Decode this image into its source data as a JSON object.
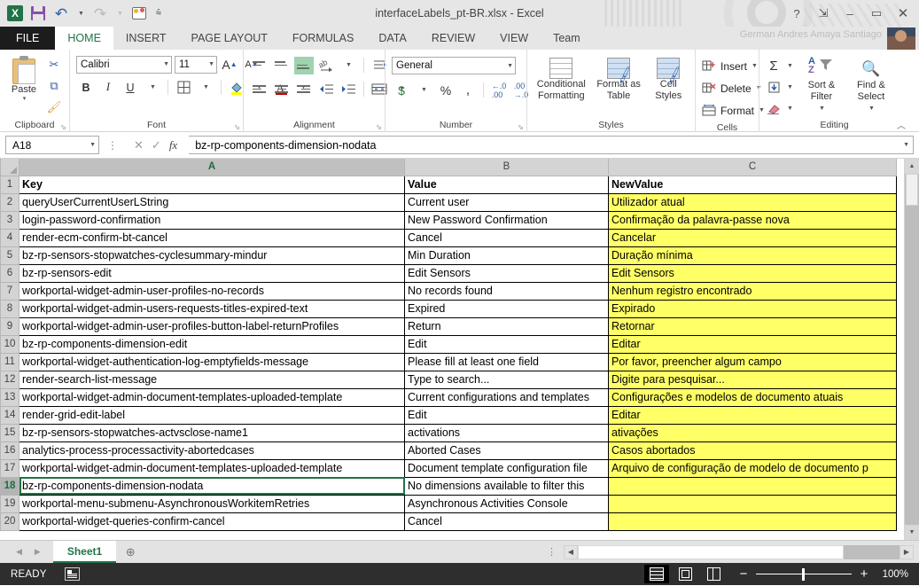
{
  "window": {
    "title": "interfaceLabels_pt-BR.xlsx - Excel",
    "user_name": "German Andres Amaya Santiago",
    "help_icon": "?",
    "ribbon_display_icon": "ribbon-display-options-icon",
    "minimize_icon": "–",
    "maximize_icon": "▭",
    "close_icon": "✕"
  },
  "quick_access": {
    "app_icon": "excel-logo-icon",
    "save_icon": "save-icon",
    "undo_icon": "↶",
    "redo_icon": "↷",
    "touch_mode_icon": "touch-mode-icon",
    "customize_icon": "⩯"
  },
  "ribbon_tabs": [
    {
      "label": "FILE",
      "active": false
    },
    {
      "label": "HOME",
      "active": true
    },
    {
      "label": "INSERT",
      "active": false
    },
    {
      "label": "PAGE LAYOUT",
      "active": false
    },
    {
      "label": "FORMULAS",
      "active": false
    },
    {
      "label": "DATA",
      "active": false
    },
    {
      "label": "REVIEW",
      "active": false
    },
    {
      "label": "VIEW",
      "active": false
    },
    {
      "label": "Team",
      "active": false
    }
  ],
  "ribbon": {
    "clipboard": {
      "title": "Clipboard",
      "paste_label": "Paste",
      "paste_caret": "▾",
      "cut_icon": "✂",
      "copy_icon": "⧉",
      "format_painter_icon": "🖌",
      "dialog_launcher": "⬂"
    },
    "font": {
      "title": "Font",
      "font_name": "Calibri",
      "font_size": "11",
      "grow_font": "A",
      "shrink_font": "A",
      "bold": "B",
      "italic": "I",
      "underline": "U",
      "borders_icon": "borders-icon",
      "fill_color_icon": "fill-color-icon",
      "font_color_icon": "A",
      "dropdown_caret": "▾",
      "dialog_launcher": "⬂"
    },
    "alignment": {
      "title": "Alignment",
      "top_align": "align-top-icon",
      "middle_align": "align-middle-icon",
      "bottom_align": "align-bottom-icon",
      "orientation": "orientation-icon",
      "align_left": "align-left-icon",
      "align_center": "align-center-icon",
      "align_right": "align-right-icon",
      "decrease_indent": "decrease-indent-icon",
      "increase_indent": "increase-indent-icon",
      "wrap_text": "wrap-text-icon",
      "merge_center": "merge-and-center-icon",
      "dialog_launcher": "⬂"
    },
    "number": {
      "title": "Number",
      "format": "General",
      "accounting": "$",
      "percent": "%",
      "comma": ",",
      "increase_decimal": ".00",
      "decrease_decimal": ".0",
      "dialog_launcher": "⬂"
    },
    "styles": {
      "title": "Styles",
      "conditional_formatting": "Conditional Formatting",
      "format_as_table": "Format as Table",
      "cell_styles": "Cell Styles",
      "caret": "▾"
    },
    "cells": {
      "title": "Cells",
      "insert": "Insert",
      "delete": "Delete",
      "format": "Format",
      "caret": "▾"
    },
    "editing": {
      "title": "Editing",
      "autosum": "Σ",
      "fill": "fill-icon",
      "clear": "clear-icon",
      "sort_filter": "Sort & Filter",
      "find_select": "Find & Select",
      "caret": "▾",
      "collapse_ribbon": "︿"
    }
  },
  "formula_bar": {
    "name_box_value": "A18",
    "name_box_caret": "▾",
    "separator": "⋮",
    "cancel_icon": "✕",
    "enter_icon": "✓",
    "function_icon": "fx",
    "formula_value": "bz-rp-components-dimension-nodata",
    "expand_caret": "▾"
  },
  "grid": {
    "columns": [
      "A",
      "B",
      "C"
    ],
    "selected_column": "A",
    "selected_row": 18,
    "active_cell": "A18",
    "rows": [
      {
        "n": 1,
        "a": "Key",
        "b": "Value",
        "c": "NewValue",
        "header": true,
        "highlight": false
      },
      {
        "n": 2,
        "a": "queryUserCurrentUserLString",
        "b": "Current user",
        "c": "Utilizador atual",
        "header": false,
        "highlight": true
      },
      {
        "n": 3,
        "a": "login-password-confirmation",
        "b": "New Password Confirmation",
        "c": "Confirmação da palavra-passe nova",
        "header": false,
        "highlight": true
      },
      {
        "n": 4,
        "a": "render-ecm-confirm-bt-cancel",
        "b": "Cancel",
        "c": "Cancelar",
        "header": false,
        "highlight": true
      },
      {
        "n": 5,
        "a": "bz-rp-sensors-stopwatches-cyclesummary-mindur",
        "b": "Min Duration",
        "c": "Duração mínima",
        "header": false,
        "highlight": true
      },
      {
        "n": 6,
        "a": "bz-rp-sensors-edit",
        "b": "Edit Sensors",
        "c": "Edit Sensors",
        "header": false,
        "highlight": true
      },
      {
        "n": 7,
        "a": "workportal-widget-admin-user-profiles-no-records",
        "b": "No records found",
        "c": "Nenhum registro encontrado",
        "header": false,
        "highlight": true
      },
      {
        "n": 8,
        "a": "workportal-widget-admin-users-requests-titles-expired-text",
        "b": "Expired",
        "c": "Expirado",
        "header": false,
        "highlight": true
      },
      {
        "n": 9,
        "a": "workportal-widget-admin-user-profiles-button-label-returnProfiles",
        "b": "Return",
        "c": "Retornar",
        "header": false,
        "highlight": true
      },
      {
        "n": 10,
        "a": "bz-rp-components-dimension-edit",
        "b": "Edit",
        "c": "Editar",
        "header": false,
        "highlight": true
      },
      {
        "n": 11,
        "a": "workportal-widget-authentication-log-emptyfields-message",
        "b": "Please fill at least one field",
        "c": "Por favor, preencher algum campo",
        "header": false,
        "highlight": true
      },
      {
        "n": 12,
        "a": "render-search-list-message",
        "b": "Type to search...",
        "c": "Digite para pesquisar...",
        "header": false,
        "highlight": true
      },
      {
        "n": 13,
        "a": "workportal-widget-admin-document-templates-uploaded-template",
        "b": "Current configurations and templates",
        "c": "Configurações e modelos de documento atuais",
        "header": false,
        "highlight": true
      },
      {
        "n": 14,
        "a": "render-grid-edit-label",
        "b": "Edit",
        "c": "Editar",
        "header": false,
        "highlight": true
      },
      {
        "n": 15,
        "a": "bz-rp-sensors-stopwatches-actvsclose-name1",
        "b": "activations",
        "c": "ativações",
        "header": false,
        "highlight": true
      },
      {
        "n": 16,
        "a": "analytics-process-processactivity-abortedcases",
        "b": "Aborted Cases",
        "c": "Casos abortados",
        "header": false,
        "highlight": true
      },
      {
        "n": 17,
        "a": "workportal-widget-admin-document-templates-uploaded-template",
        "b": "Document template configuration file",
        "c": "Arquivo de configuração de modelo de documento p",
        "header": false,
        "highlight": true
      },
      {
        "n": 18,
        "a": "bz-rp-components-dimension-nodata",
        "b": "No dimensions available to filter this",
        "c": "",
        "header": false,
        "highlight": true
      },
      {
        "n": 19,
        "a": "workportal-menu-submenu-AsynchronousWorkitemRetries",
        "b": "Asynchronous Activities Console",
        "c": "",
        "header": false,
        "highlight": true
      },
      {
        "n": 20,
        "a": "workportal-widget-queries-confirm-cancel",
        "b": "Cancel",
        "c": "",
        "header": false,
        "highlight": true
      }
    ],
    "scroll_up_icon": "▲",
    "scroll_down_icon": "▼"
  },
  "sheet_tabs": {
    "prev_icon": "◀",
    "next_icon": "▶",
    "sheets": [
      "Sheet1"
    ],
    "active_sheet": "Sheet1",
    "add_sheet_icon": "⊕",
    "ellipsis": "⋮",
    "hscroll_left_icon": "◀",
    "hscroll_right_icon": "▶"
  },
  "status_bar": {
    "state": "READY",
    "macro_icon": "record-macro-icon",
    "views": [
      {
        "name": "normal-view",
        "icon": "grid-icon",
        "active": true
      },
      {
        "name": "page-layout-view",
        "icon": "page-icon",
        "active": false
      },
      {
        "name": "page-break-preview",
        "icon": "page-break-icon",
        "active": false
      }
    ],
    "zoom_out": "−",
    "zoom_in": "+",
    "zoom_level": "100%"
  },
  "colors": {
    "accent": "#217346",
    "highlight_fill": "#ffff66",
    "titlebar_bg": "#e6e6e6",
    "statusbar_bg": "#2e2e2e"
  }
}
